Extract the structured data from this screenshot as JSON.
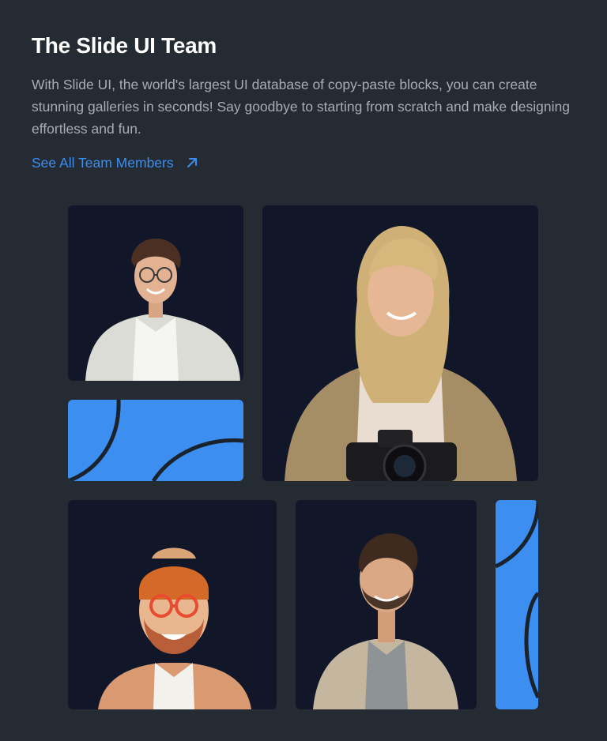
{
  "header": {
    "title": "The Slide UI Team",
    "description": "With Slide UI, the world's largest UI database of copy-paste blocks, you can create stunning galleries in seconds! Say goodbye to starting from scratch and make designing effortless and fun.",
    "link_label": "See All Team Members",
    "link_icon": "arrow-up-right-icon"
  },
  "colors": {
    "background": "#252b32",
    "accent": "#3c8ef0",
    "link": "#3b8df0",
    "tile_background": "#111729"
  }
}
